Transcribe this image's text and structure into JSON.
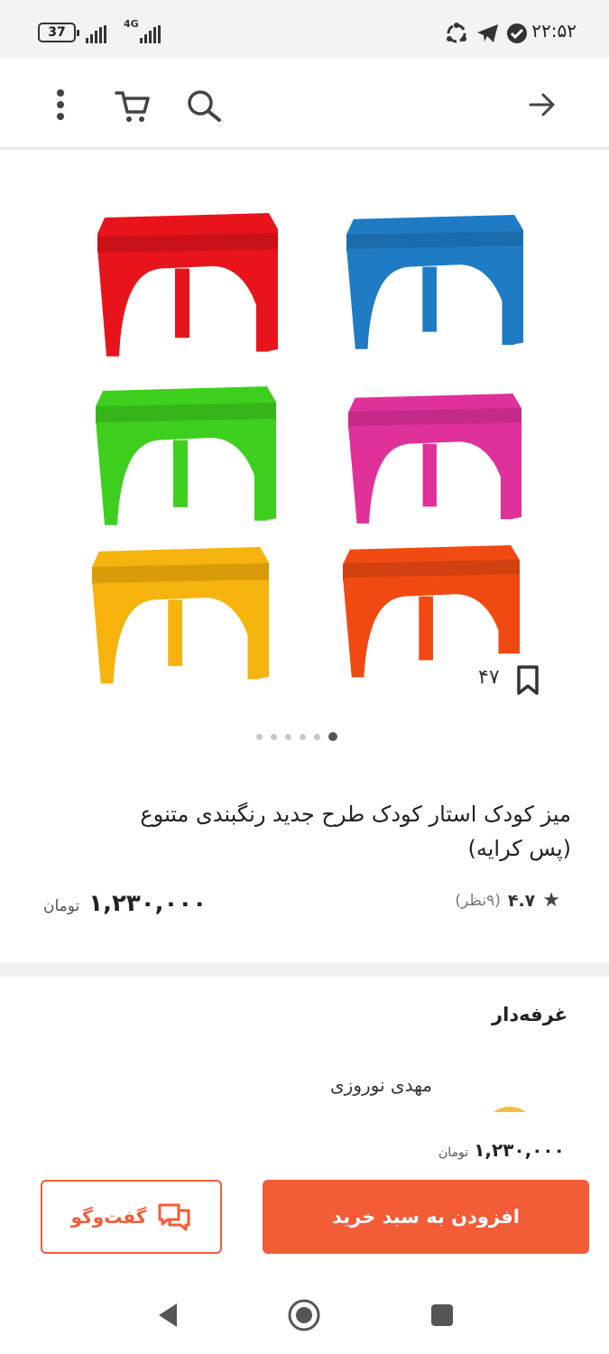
{
  "status_bar": {
    "time": "۲۲:۵۲",
    "battery": "37",
    "network": "4G",
    "icons": [
      "telegram-icon",
      "shield-check-icon",
      "recycle-icon"
    ]
  },
  "header": {
    "icons": [
      "back-arrow-icon",
      "search-icon",
      "cart-icon",
      "more-vert-icon"
    ]
  },
  "gallery": {
    "product_colors": [
      "#1f7bc4",
      "#e8141c",
      "#e0309a",
      "#3ecf1e",
      "#f04a12",
      "#f6b20d"
    ],
    "bookmark_count": "۴۷",
    "dots_total": 6,
    "active_dot": 1
  },
  "product": {
    "title_line1": "میز کودک استار کودک طرح جدید رنگبندی متنوع",
    "title_line2": "(پس کرایه)",
    "rating": "۴.۷",
    "reviews": "(۹نظر)",
    "price": "۱,۲۳۰,۰۰۰",
    "currency": "تومان"
  },
  "seller": {
    "section_label": "غرفه‌دار",
    "name": "مهدی نوروزی"
  },
  "buy_bar": {
    "price": "۱,۲۳۰,۰۰۰",
    "currency": "تومان",
    "add_to_cart_label": "افزودن به سبد خرید",
    "chat_label": "گفت‌وگو"
  },
  "accent_color": "#f45b37"
}
